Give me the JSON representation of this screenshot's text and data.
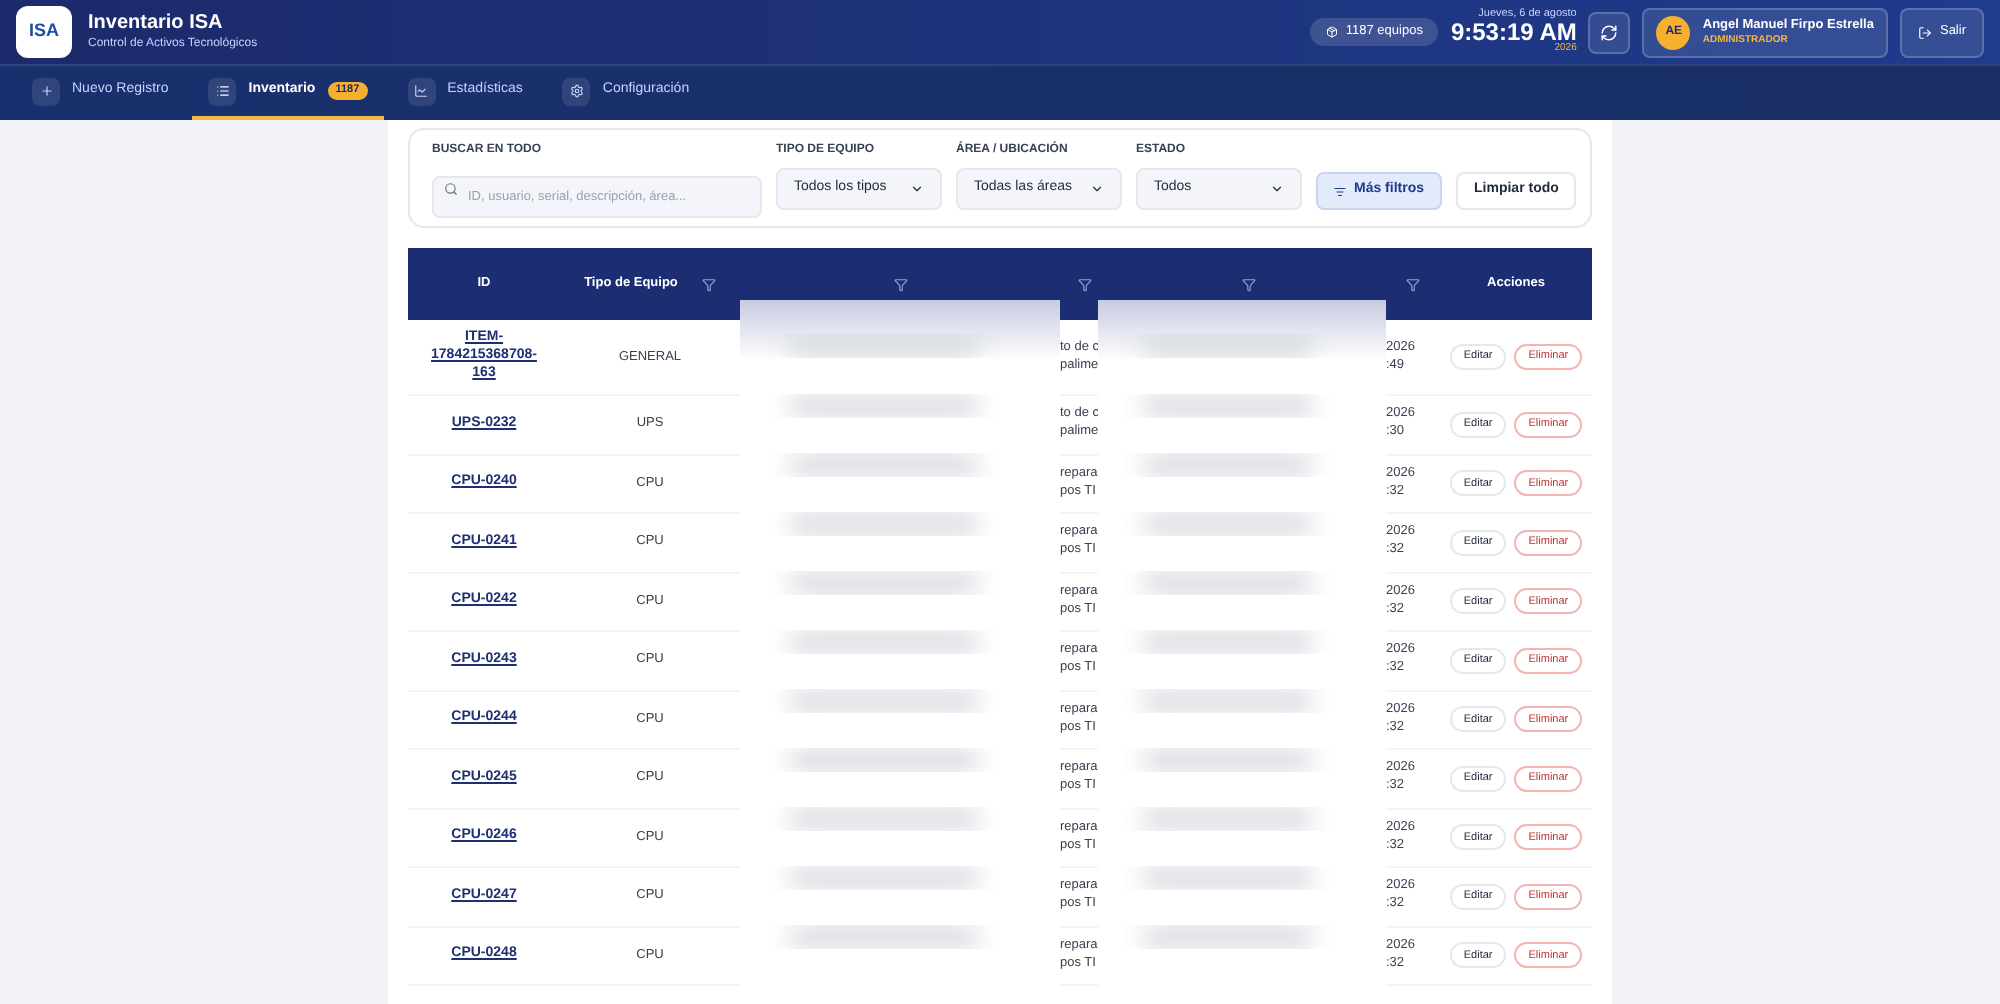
{
  "app": {
    "logo_text": "ISA",
    "title": "Inventario ISA",
    "subtitle": "Control de Activos Tecnológicos"
  },
  "header": {
    "count_badge": "1187 equipos",
    "date": "Jueves, 6 de agosto",
    "time": "9:53:19 AM",
    "year": "2026",
    "user": {
      "initials": "AE",
      "name": "Angel Manuel Firpo Estrella",
      "role": "ADMINISTRADOR"
    },
    "logout": "Salir"
  },
  "nav": [
    {
      "label": "Nuevo Registro",
      "selected": false
    },
    {
      "label": "Inventario",
      "badge": "1187",
      "selected": true
    },
    {
      "label": "Estadísticas",
      "selected": false
    },
    {
      "label": "Configuración",
      "selected": false
    }
  ],
  "filters": {
    "search": {
      "label": "BUSCAR EN TODO",
      "placeholder": "ID, usuario, serial, descripción, área..."
    },
    "selects": [
      {
        "label": "TIPO DE EQUIPO",
        "value": "Todos los tipos"
      },
      {
        "label": "ÁREA / UBICACIÓN",
        "value": "Todas las áreas"
      },
      {
        "label": "ESTADO",
        "value": "Todos"
      }
    ],
    "more": "Más filtros",
    "clear": "Limpiar todo"
  },
  "table": {
    "columns": [
      {
        "label": "ID",
        "filter": false
      },
      {
        "label": "Tipo de Equipo",
        "filter": true
      },
      {
        "filter": true
      },
      {
        "filter": true
      },
      {
        "filter": true
      },
      {
        "filter": true
      },
      {
        "label": "Acciones",
        "filter": false
      }
    ],
    "rows": [
      {
        "id": "ITEM-1784215368708-163",
        "type": "GENERAL",
        "location": [
          "to de c",
          "palime"
        ],
        "date": [
          "2026",
          ":49"
        ],
        "edit": "Editar",
        "delete": "Eliminar"
      },
      {
        "id": "UPS-0232",
        "type": "UPS",
        "location": [
          "to de c",
          "palime"
        ],
        "date": [
          "2026",
          ":30"
        ],
        "edit": "Editar",
        "delete": "Eliminar"
      },
      {
        "id": "CPU-0240",
        "type": "CPU",
        "location": [
          "repara",
          "pos TI"
        ],
        "date": [
          "2026",
          ":32"
        ],
        "edit": "Editar",
        "delete": "Eliminar"
      },
      {
        "id": "CPU-0241",
        "type": "CPU",
        "location": [
          "repara",
          "pos TI"
        ],
        "date": [
          "2026",
          ":32"
        ],
        "edit": "Editar",
        "delete": "Eliminar"
      },
      {
        "id": "CPU-0242",
        "type": "CPU",
        "location": [
          "repara",
          "pos TI"
        ],
        "date": [
          "2026",
          ":32"
        ],
        "edit": "Editar",
        "delete": "Eliminar"
      },
      {
        "id": "CPU-0243",
        "type": "CPU",
        "location": [
          "repara",
          "pos TI"
        ],
        "date": [
          "2026",
          ":32"
        ],
        "edit": "Editar",
        "delete": "Eliminar"
      },
      {
        "id": "CPU-0244",
        "type": "CPU",
        "location": [
          "repara",
          "pos TI"
        ],
        "date": [
          "2026",
          ":32"
        ],
        "edit": "Editar",
        "delete": "Eliminar"
      },
      {
        "id": "CPU-0245",
        "type": "CPU",
        "location": [
          "repara",
          "pos TI"
        ],
        "date": [
          "2026",
          ":32"
        ],
        "edit": "Editar",
        "delete": "Eliminar"
      },
      {
        "id": "CPU-0246",
        "type": "CPU",
        "location": [
          "repara",
          "pos TI"
        ],
        "date": [
          "2026",
          ":32"
        ],
        "edit": "Editar",
        "delete": "Eliminar"
      },
      {
        "id": "CPU-0247",
        "type": "CPU",
        "location": [
          "repara",
          "pos TI"
        ],
        "date": [
          "2026",
          ":32"
        ],
        "edit": "Editar",
        "delete": "Eliminar"
      },
      {
        "id": "CPU-0248",
        "type": "CPU",
        "location": [
          "repara",
          "pos TI"
        ],
        "date": [
          "2026",
          ":32"
        ],
        "edit": "Editar",
        "delete": "Eliminar"
      }
    ]
  }
}
